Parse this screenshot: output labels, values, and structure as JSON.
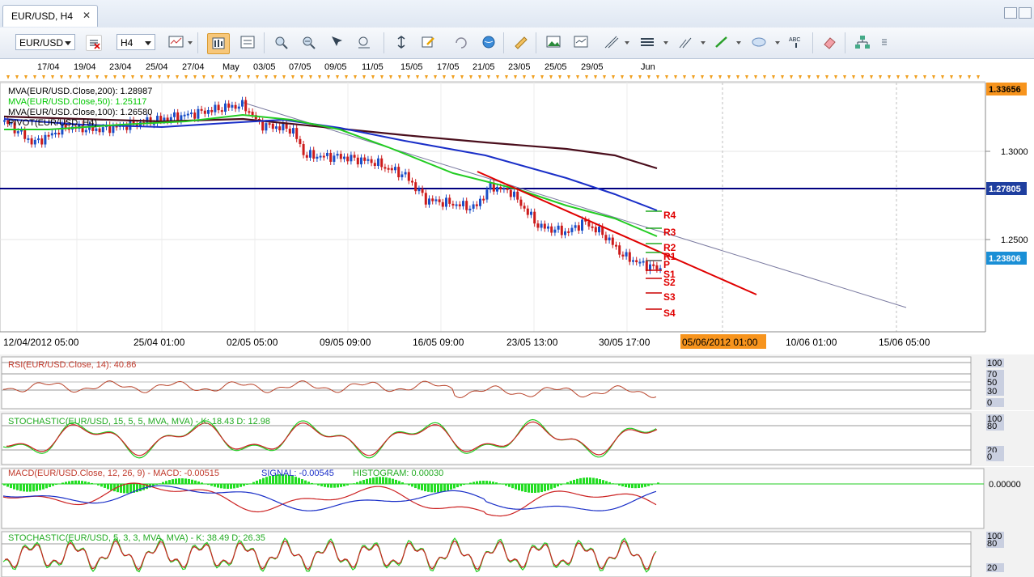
{
  "window": {
    "tab_title": "EUR/USD, H4",
    "close_glyph": "✕"
  },
  "toolbar": {
    "symbol": "EUR/USD",
    "timeframe": "H4",
    "icons": [
      "chart-type-icon",
      "chart-style-active-icon",
      "data-window-icon",
      "zoom-in-icon",
      "zoom-out-icon",
      "crosshair-icon",
      "zoom-area-icon",
      "auto-scale-icon",
      "edit-icon",
      "rotate-icon",
      "globe-icon",
      "ruler-icon",
      "landscape-icon",
      "template-icon",
      "fibonacci-icon",
      "horizontal-lines-icon",
      "trend-line-icon",
      "draw-line-icon",
      "ellipse-icon",
      "text-label-icon",
      "eraser-icon",
      "hierarchy-icon"
    ]
  },
  "top_axis": {
    "labels": [
      "17/04",
      "19/04",
      "23/04",
      "25/04",
      "27/04",
      "May",
      "03/05",
      "07/05",
      "09/05",
      "11/05",
      "15/05",
      "17/05",
      "21/05",
      "23/05",
      "25/05",
      "29/05",
      "Jun"
    ]
  },
  "main_chart": {
    "legend": [
      {
        "text": "MVA(EUR/USD.Close,200): 1.28987",
        "color": "#000000"
      },
      {
        "text": "MVA(EUR/USD.Close,50): 1.25117",
        "color": "#00c800"
      },
      {
        "text": "MVA(EUR/USD.Close,100): 1.26580",
        "color": "#000000"
      },
      {
        "text": "PIVOT(EUR/USD, H4)",
        "color": "#000000"
      }
    ],
    "price_axis": {
      "ticks": [
        "1.3000",
        "1.2500"
      ],
      "badges": [
        {
          "text": "1.33656",
          "bg": "#f7941d"
        },
        {
          "text": "1.27805",
          "bg": "#1f3f9f"
        },
        {
          "text": "1.23806",
          "bg": "#1a8fd6"
        }
      ]
    },
    "pivot_labels": [
      "R4",
      "R3",
      "R2",
      "R1",
      "P",
      "S1",
      "S2",
      "S3",
      "S4"
    ],
    "time_axis": [
      "12/04/2012 05:00",
      "25/04 01:00",
      "02/05 05:00",
      "09/05 09:00",
      "16/05 09:00",
      "23/05 13:00",
      "30/05 17:00",
      "05/06/2012 01:00",
      "10/06 01:00",
      "15/06 05:00"
    ],
    "time_highlight": "05/06/2012 01:00",
    "colors": {
      "ma200": "#4a0e1c",
      "ma50": "#22cc22",
      "ma100": "#1a2fc8",
      "trend_red": "#e00000",
      "level": "#000080"
    }
  },
  "rsi": {
    "legend": "RSI(EUR/USD.Close, 14): 40.86",
    "axis": [
      "100",
      "70",
      "50",
      "30",
      "0"
    ]
  },
  "stoch1": {
    "legend": "STOCHASTIC(EUR/USD, 15, 5, 5, MVA, MVA) -  K: 18.43   D: 12.98",
    "axis": [
      "100",
      "80",
      "20",
      "0"
    ]
  },
  "macd": {
    "legend_a": "MACD(EUR/USD.Close, 12, 26, 9) - MACD: -0.00515",
    "legend_b": "SIGNAL: -0.00545",
    "legend_c": "HISTOGRAM: 0.00030",
    "axis": [
      "0.00000"
    ]
  },
  "stoch2": {
    "legend": "STOCHASTIC(EUR/USD, 5, 3, 3, MVA, MVA) -  K: 38.49   D: 26.35",
    "axis": [
      "100",
      "80",
      "20"
    ]
  }
}
